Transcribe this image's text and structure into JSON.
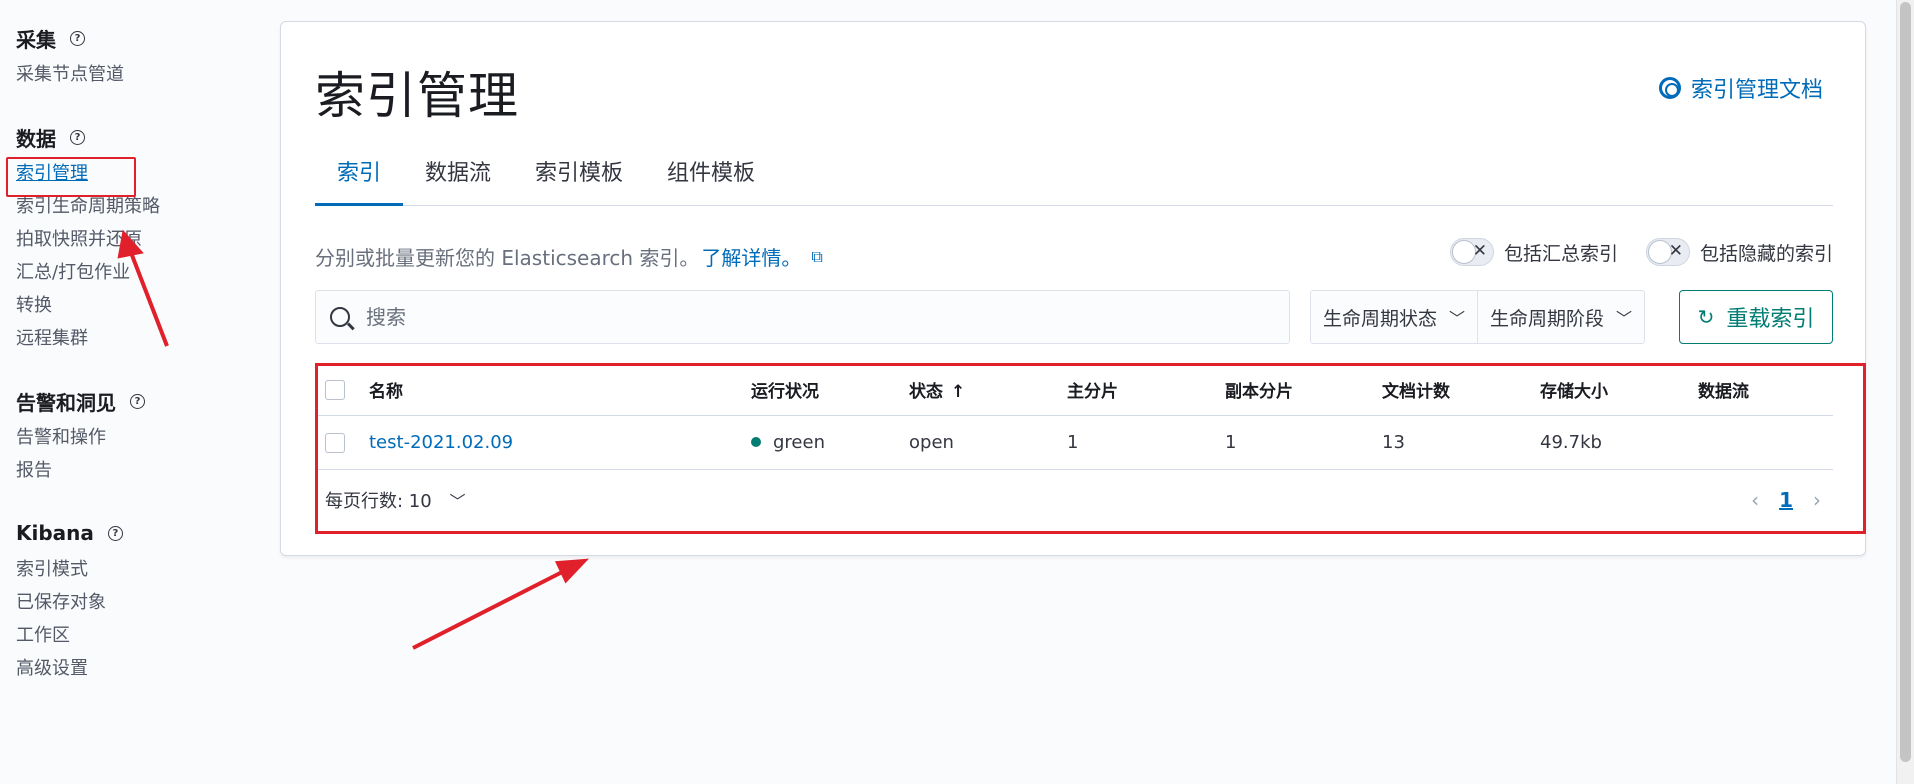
{
  "sidebar": {
    "groups": [
      {
        "title": "采集",
        "items": [
          "采集节点管道"
        ]
      },
      {
        "title": "数据",
        "items": [
          "索引管理",
          "索引生命周期策略",
          "拍取快照并还原",
          "汇总/打包作业",
          "转换",
          "远程集群"
        ]
      },
      {
        "title": "告警和洞见",
        "items": [
          "告警和操作",
          "报告"
        ]
      },
      {
        "title": "Kibana",
        "items": [
          "索引模式",
          "已保存对象",
          "工作区",
          "高级设置"
        ]
      }
    ],
    "help_icon": "question-circle-icon"
  },
  "header": {
    "title": "索引管理",
    "doc_link": "索引管理文档",
    "doc_icon": "lifering-icon"
  },
  "tabs": [
    "索引",
    "数据流",
    "索引模板",
    "组件模板"
  ],
  "description": {
    "text": "分别或批量更新您的 Elasticsearch 索引。",
    "link": "了解详情。"
  },
  "toggles": [
    {
      "label": "包括汇总索引",
      "on": false
    },
    {
      "label": "包括隐藏的索引",
      "on": false
    }
  ],
  "search": {
    "placeholder": "搜索",
    "value": ""
  },
  "filters": [
    "生命周期状态",
    "生命周期阶段"
  ],
  "reload_button": "重载索引",
  "table": {
    "columns": [
      "名称",
      "运行状况",
      "状态",
      "主分片",
      "副本分片",
      "文档计数",
      "存储大小",
      "数据流"
    ],
    "sort_column": "状态",
    "rows": [
      {
        "name": "test-2021.02.09",
        "health": "green",
        "status": "open",
        "primary": "1",
        "replicas": "1",
        "docs": "13",
        "size": "49.7kb",
        "data_stream": ""
      }
    ]
  },
  "pagination": {
    "rows_per_page": "每页行数: 10",
    "current_page": "1"
  },
  "colors": {
    "accent": "#006bb8",
    "success": "#017d73",
    "annotation": "#e0202a"
  }
}
